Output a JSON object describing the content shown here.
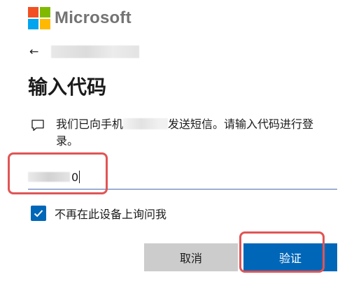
{
  "brand": {
    "name": "Microsoft",
    "logo_colors": [
      "#f25022",
      "#7fba00",
      "#00a4ef",
      "#ffb900"
    ]
  },
  "back": {
    "icon": "arrow-left-icon"
  },
  "heading": "输入代码",
  "message": {
    "icon": "chat-bubble-icon",
    "text_before": "我们已向手机",
    "text_after": "发送短信。请输入代码进行登录。"
  },
  "code_input": {
    "value_tail": "0"
  },
  "keep_signed_in": {
    "label": "不再在此设备上询问我",
    "checked": true
  },
  "buttons": {
    "cancel_label": "取消",
    "verify_label": "验证"
  },
  "colors": {
    "accent": "#0067b8",
    "annotation": "#e05555",
    "cancel_bg": "#cccccc"
  }
}
